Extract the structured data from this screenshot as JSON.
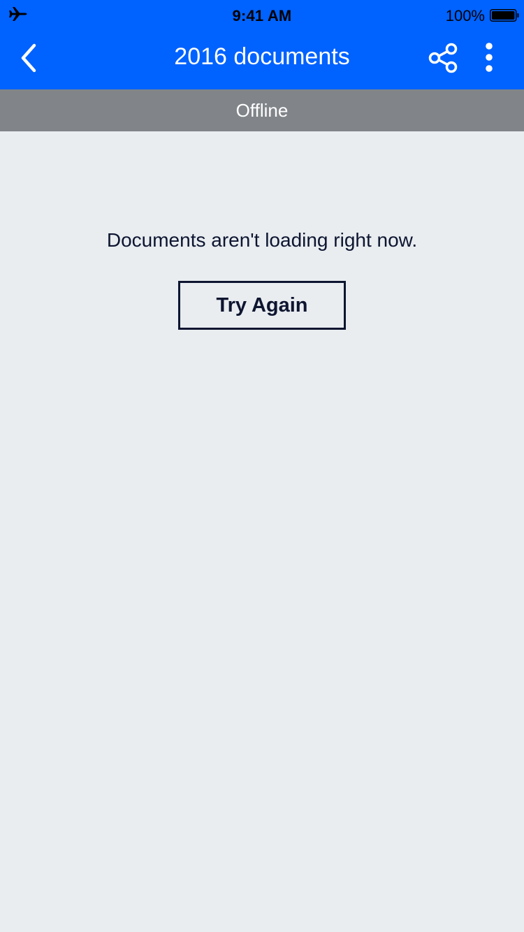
{
  "status_bar": {
    "time": "9:41 AM",
    "battery_percent": "100%",
    "left_icon": "airplane-icon",
    "battery_icon": "battery-full-icon"
  },
  "nav": {
    "title": "2016 documents",
    "back_icon": "chevron-left-icon",
    "share_icon": "share-icon",
    "more_icon": "more-vertical-icon"
  },
  "banner": {
    "text": "Offline"
  },
  "empty_state": {
    "message": "Documents aren't loading right now.",
    "button_label": "Try Again"
  },
  "colors": {
    "nav_background": "#0062ff",
    "banner_background": "#818589",
    "page_background": "#e9edf0",
    "text_dark": "#0d1530"
  }
}
